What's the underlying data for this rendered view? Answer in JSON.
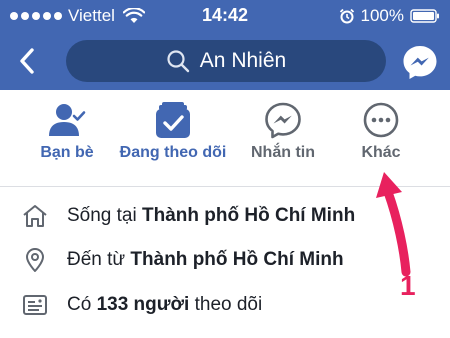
{
  "status_bar": {
    "carrier": "Viettel",
    "time": "14:42",
    "battery": "100%"
  },
  "nav": {
    "search_text": "An Nhiên"
  },
  "actions": [
    {
      "label": "Bạn bè",
      "icon": "friends-icon"
    },
    {
      "label": "Đang theo dõi",
      "icon": "following-icon"
    },
    {
      "label": "Nhắn tin",
      "icon": "messenger-icon"
    },
    {
      "label": "Khác",
      "icon": "more-icon"
    }
  ],
  "info": {
    "lives_prefix": "Sống tại ",
    "lives_city": "Thành phố Hồ Chí Minh",
    "from_prefix": "Đến từ ",
    "from_city": "Thành phố Hồ Chí Minh",
    "followers_prefix": "Có ",
    "followers_count": "133 người",
    "followers_suffix": " theo dõi"
  },
  "annotation": {
    "number": "1",
    "color": "#e8215e"
  },
  "colors": {
    "brand": "#4267b2",
    "search_bg": "#29487d"
  }
}
